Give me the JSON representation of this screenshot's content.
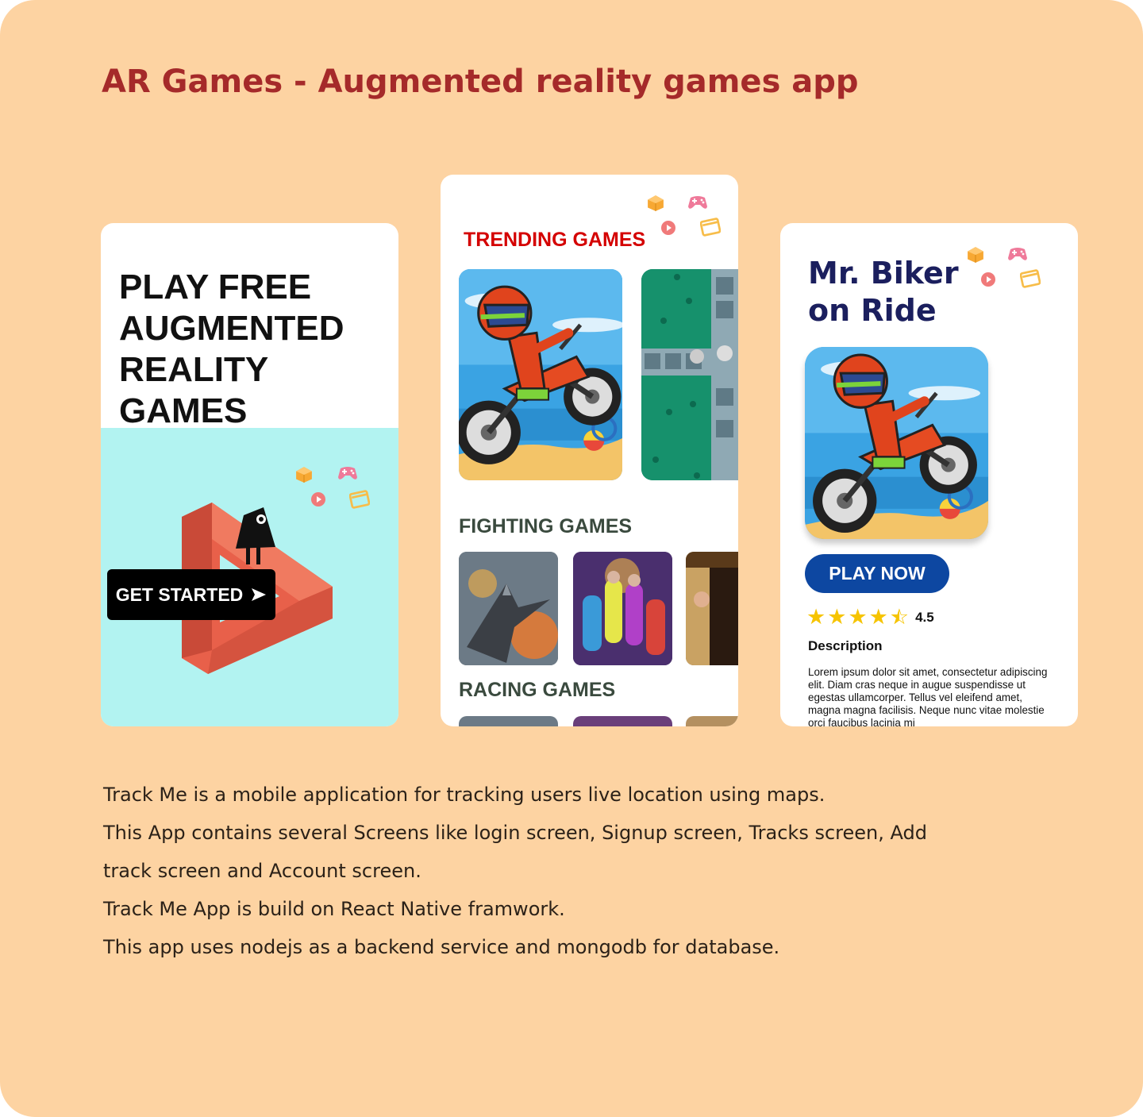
{
  "page": {
    "title": "AR Games - Augmented reality games app",
    "accent_color": "#a52a2a",
    "background_color": "#fdd3a2"
  },
  "card_welcome": {
    "headline_lines": [
      "PLAY FREE",
      "AUGMENTED",
      "REALITY",
      "GAMES"
    ],
    "cta_label": "GET STARTED",
    "cta_icon": "arrow-right-icon",
    "panel_color": "#b2f3f1",
    "decor_icons": [
      "cube-icon",
      "gamepad-icon",
      "play-icon",
      "window-icon"
    ]
  },
  "card_home": {
    "sections": [
      {
        "label": "TRENDING GAMES",
        "color": "#d40000"
      },
      {
        "label": "FIGHTING GAMES",
        "color": "#3a4a3e"
      },
      {
        "label": "RACING GAMES",
        "color": "#3a4a3e"
      }
    ],
    "decor_icons": [
      "cube-icon",
      "gamepad-icon",
      "play-icon",
      "window-icon"
    ]
  },
  "card_detail": {
    "title_lines": [
      "Mr. Biker",
      "on Ride"
    ],
    "play_label": "PLAY NOW",
    "rating_value": "4.5",
    "rating_stars": 4.5,
    "description_heading": "Description",
    "description_text": "Lorem ipsum dolor sit amet, consectetur adipiscing elit. Diam cras neque in augue suspendisse ut egestas ullamcorper. Tellus vel eleifend amet, magna magna facilisis. Neque nunc vitae molestie orci faucibus lacinia mi",
    "button_color": "#0d47a1",
    "star_color": "#f6c400",
    "decor_icons": [
      "cube-icon",
      "gamepad-icon",
      "play-icon",
      "window-icon"
    ]
  },
  "description_lines": [
    "Track Me is a mobile application for tracking users live location using maps.",
    "This App contains several Screens like login screen, Signup screen, Tracks screen, Add",
    "track screen and Account screen.",
    "Track Me App is build on React Native framwork.",
    "This app uses nodejs as a backend service and mongodb for database."
  ]
}
